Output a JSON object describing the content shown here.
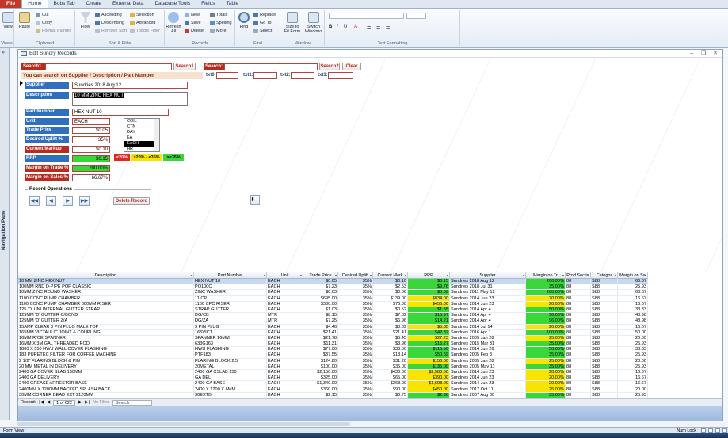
{
  "tabs": [
    "File",
    "Home",
    "Bobs Tab",
    "Create",
    "External Data",
    "Database Tools",
    "Fields",
    "Table"
  ],
  "ribbon": {
    "groups": [
      "Views",
      "Clipboard",
      "Sort & Filter",
      "Records",
      "Find",
      "Window",
      "Text Formatting"
    ],
    "view": "View",
    "paste": "Paste",
    "cut": "Cut",
    "copy": "Copy",
    "format_painter": "Format Painter",
    "filter": "Filter",
    "ascending": "Ascending",
    "descending": "Descending",
    "remove_sort": "Remove Sort",
    "selection": "Selection",
    "advanced": "Advanced",
    "toggle_filter": "Toggle Filter",
    "refresh": "Refresh All",
    "new": "New",
    "save": "Save",
    "delete": "Delete",
    "totals": "Totals",
    "spelling": "Spelling",
    "more": "More",
    "find": "Find",
    "replace": "Replace",
    "goto": "Go To",
    "select": "Select",
    "size_to_fit": "Size to Fit Form",
    "switch_windows": "Switch Windows"
  },
  "nav_pane": {
    "label": "Navigation Pane",
    "toggle": "»"
  },
  "form": {
    "title": "Edit Sundry Records",
    "search1_label": "Search1",
    "search1_btn": "Search1",
    "search_label": "Search:",
    "search2_btn": "Search2",
    "clear_btn": "Clear",
    "hint": "You can search on Supplier / Description / Part Number",
    "txt_labels": [
      "txt0:",
      "txt1:",
      "txt2:",
      "txt3:"
    ],
    "supplier_label": "Supplier",
    "supplier": "Sundries 2018 Aug 12",
    "description_label": "Description",
    "description": "10 MM ZINC HEX NUT",
    "part_label": "Part Number",
    "part": "HEX NUT 10",
    "unit_label": "Unit",
    "unit": "EACH",
    "unit_options": [
      "COIL",
      "CTN",
      "DAY",
      "EA",
      "EACH",
      "HR"
    ],
    "unit_selected": "EACH",
    "trade_label": "Trade Price",
    "trade": "$0.05",
    "uplift_label": "Desired Uplift %",
    "uplift": "35%",
    "markup_label": "Current Markup",
    "markup": "$0.10",
    "rrp_label": "RRP",
    "rrp": "$0.15",
    "mtrade_label": "Margin on Trade %",
    "mtrade": "200.00%",
    "msales_label": "Margin on Sales %",
    "msales": "66.67%",
    "legend": [
      "<20%",
      ">20% - <35%",
      ">=35%"
    ],
    "legend_colors": [
      "#e8271b",
      "#f7e400",
      "#3ad63a"
    ],
    "ops_label": "Record Operations",
    "delete_btn": "Delete Record"
  },
  "sheet": {
    "columns": [
      "Description",
      "Part Number",
      "Unit",
      "Trade Price",
      "Desired Uplift",
      "Current Mark",
      "RRP",
      "Supplier",
      "Margin on Tr",
      "Prod Sectio",
      "Categor",
      "Margin on Sa"
    ],
    "rows": [
      [
        "10 MM ZINC HEX NUT",
        "HEX NUT 10",
        "EACH",
        "$0.05",
        "35%",
        "$0.10",
        "$0.15",
        "Sundries 2018 Aug 12",
        "200.00%",
        "88",
        "S88",
        "66.67"
      ],
      [
        "100MM RND D-PIPE POP CLASSIC",
        "PO100C",
        "EACH",
        "$7.23",
        "35%",
        "$2.53",
        "$9.76",
        "Sundries 2018 Jul 31",
        "35.00%",
        "88",
        "S88",
        "25.93"
      ],
      [
        "10MM ZINC ROUND WASHER",
        "ZINC WASHER",
        "EACH",
        "$0.03",
        "35%",
        "$0.06",
        "$0.09",
        "Sundries 2011 May 12",
        "200.00%",
        "88",
        "S88",
        "66.67"
      ],
      [
        "1100 CONC PUMP CHAMBER",
        "11 CP",
        "EACH",
        "$695.00",
        "35%",
        "$139.00",
        "$834.00",
        "Sundries 2014 Jun 23",
        "20.00%",
        "88",
        "S88",
        "16.67"
      ],
      [
        "1100 CONC PUMP CHAMBER 300MM RISER",
        "1100 CPC RISER",
        "EACH",
        "$380.00",
        "35%",
        "$76.00",
        "$456.00",
        "Sundries 2014 Jun 23",
        "20.00%",
        "88",
        "S88",
        "16.67"
      ],
      [
        "125 'D' UNI INTERNAL GUTTER STRAP",
        "STRAP GUTTER",
        "EACH",
        "$1.03",
        "35%",
        "$0.52",
        "$1.55",
        "Sundries 2014 Apr 4",
        "50.00%",
        "88",
        "S88",
        "33.33"
      ],
      [
        "125MM 'D' GUTTER C/BOND",
        "DG/CB",
        "MTR",
        "$8.15",
        "35%",
        "$7.82",
        "$15.97",
        "Sundries 2014 Apr 4",
        "96.00%",
        "88",
        "S88",
        "48.98"
      ],
      [
        "125MM 'D' GUTTER Z/A",
        "DG/ZA",
        "MTR",
        "$7.25",
        "35%",
        "$6.96",
        "$14.21",
        "Sundries 2014 Apr 4",
        "96.00%",
        "88",
        "S88",
        "48.98"
      ],
      [
        "15AMP CLEAR 3 PIN PLUG MALE TOP",
        "3 PIN PLUG",
        "EACH",
        "$4.46",
        "35%",
        "$0.89",
        "$5.35",
        "Sundries 2014 Jul 14",
        "20.00%",
        "88",
        "S88",
        "16.67"
      ],
      [
        "165MM VICTAULIC JOINT & COUPLING",
        "165VICT",
        "EACH",
        "$21.41",
        "35%",
        "$21.41",
        "$42.82",
        "Sundries 2016 Apr 1",
        "100.00%",
        "88",
        "S88",
        "50.00"
      ],
      [
        "16MM R/OE SPANNER",
        "SPANNER 16MM",
        "EACH",
        "$21.78",
        "35%",
        "$5.45",
        "$27.23",
        "Sundries 2005 Jan 28",
        "25.00%",
        "88",
        "S88",
        "20.00"
      ],
      [
        "16MM X 3M GAL THREADED ROD",
        "633G163",
        "EACH",
        "$11.31",
        "35%",
        "$3.96",
        "$15.27",
        "Sundries 2015 Mar 31",
        "35.00%",
        "88",
        "S88",
        "25.93"
      ],
      [
        "1800 X 550 HWU WALL COVER FLASHING",
        "HWU FLASHING",
        "EACH",
        "$77.00",
        "35%",
        "$38.50",
        "$115.50",
        "Sundries 2014 Jun 26",
        "50.00%",
        "88",
        "S88",
        "33.33"
      ],
      [
        "183 PURETEC FILTER FOR COFFEE MACHINE",
        "PTF183",
        "EACH",
        "$37.55",
        "35%",
        "$13.14",
        "$50.69",
        "Sundries 2005 Feb 8",
        "35.00%",
        "88",
        "S88",
        "25.93"
      ],
      [
        "2 1/2\" FLARING BLOCK & PIN",
        "FLARING BLOCK 2.5",
        "EACH",
        "$124.80",
        "35%",
        "$31.20",
        "$156.00",
        "Sundries 2005 Jan 28",
        "25.00%",
        "88",
        "S88",
        "20.00"
      ],
      [
        "20 MM METAL IN DELIVERY",
        "20METAL",
        "EACH",
        "$100.00",
        "35%",
        "$35.00",
        "$135.00",
        "Sundries 2005 May 11",
        "35.00%",
        "88",
        "S88",
        "25.93"
      ],
      [
        "2400 GA COVER SLAB 150MM",
        "2400 GA CSLAB 150",
        "EACH",
        "$2,150.00",
        "35%",
        "$430.00",
        "$2,580.00",
        "Sundries 2014 Jun 23",
        "20.00%",
        "88",
        "S88",
        "16.67"
      ],
      [
        "2400 GA DELIVERY",
        "GA DEL",
        "EACH",
        "$325.00",
        "35%",
        "$65.00",
        "$390.00",
        "Sundries 2014 Jun 23",
        "20.00%",
        "88",
        "S88",
        "16.67"
      ],
      [
        "2400 GREASE ARRESTOR BASE",
        "2400 GA BASE",
        "EACH",
        "$1,340.00",
        "35%",
        "$268.00",
        "$1,608.00",
        "Sundries 2014 Jun 23",
        "20.00%",
        "88",
        "S88",
        "16.67"
      ],
      [
        "2400MM X 1200MM BACKED SPLASH BACK",
        "2400 X 1200 X 6MM",
        "EACH",
        "$360.00",
        "35%",
        "$90.00",
        "$450.00",
        "Sundries 2017 Oct 11",
        "25.00%",
        "88",
        "S88",
        "20.00"
      ],
      [
        "30MM CORNER BEAD EXT 2120MM",
        "30EXTB",
        "EACH",
        "$2.15",
        "35%",
        "$0.75",
        "$2.90",
        "Sundries 2007 Aug 30",
        "35.00%",
        "88",
        "S88",
        "25.93"
      ],
      [
        "30MM EXTERNAL CORNER BEAD PERF 90DX3000",
        "LEN",
        "LEN",
        "$4.45",
        "35%",
        "$1.56",
        "$6.01",
        "Sundries 2017 Mar 16",
        "35.00%",
        "88",
        "S88",
        "25.93"
      ],
      [
        "3MM D SHACKLES",
        "SHACKLE 3MM",
        "EACH",
        "$1.60",
        "35%",
        "$0.80",
        "$2.40",
        "Sundries 2010 Dec 15",
        "50.00%",
        "88",
        "S88",
        "33.33"
      ],
      [
        "60M X 1.35M ROLL SISALATION 72SQM COVER",
        "SISAL60",
        "ROLL",
        "$125.00",
        "35%",
        "$43.75",
        "$168.75",
        "Sundries 2004 Mar 29",
        "35.00%",
        "88",
        "S88",
        "25.93"
      ],
      [
        "60MM BALLAST STONE",
        "60BALAST",
        "TON",
        "$55.91",
        "35%",
        "$8.19",
        "$64.10",
        "Sundries 2013 Nov 8",
        "14.65%",
        "88",
        "S88",
        "13.04"
      ]
    ],
    "rrp_colors": [
      "#3ad63a",
      "#3ad63a",
      "#3ad63a",
      "#f7e400",
      "#f7e400",
      "#3ad63a",
      "#3ad63a",
      "#3ad63a",
      "#f7e400",
      "#3ad63a",
      "#f7e400",
      "#3ad63a",
      "#3ad63a",
      "#3ad63a",
      "#f7e400",
      "#3ad63a",
      "#f7e400",
      "#f7e400",
      "#f7e400",
      "#f7e400",
      "#3ad63a",
      "#3ad63a",
      "#3ad63a",
      "#3ad63a",
      "#e8271b"
    ]
  },
  "recnav": {
    "label": "Record:",
    "position": "1 of 622",
    "filter": "No Filter",
    "search": "Search"
  },
  "status": {
    "left": "Form View",
    "right": "Num Lock"
  }
}
